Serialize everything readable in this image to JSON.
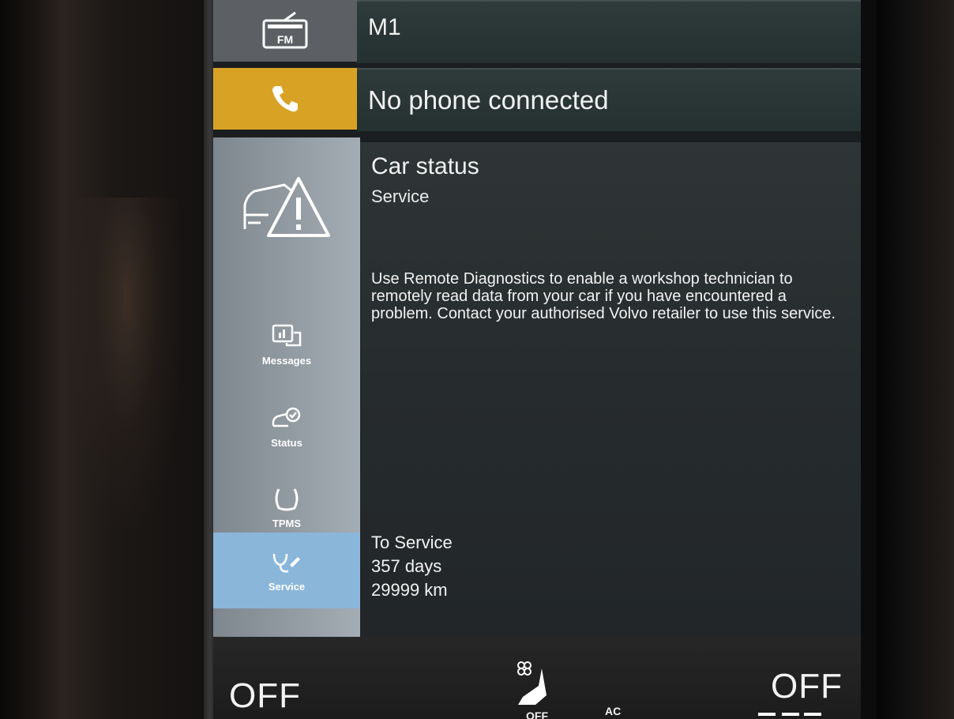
{
  "tiles": {
    "radio": {
      "icon": "fm-radio-icon",
      "badge": "FM",
      "title": "M1"
    },
    "phone": {
      "icon": "phone-icon",
      "title": "No phone connected"
    }
  },
  "app": {
    "title": "Car status",
    "subtitle": "Service",
    "description": "Use Remote Diagnostics to enable a workshop technician to remotely read data from your car if you have encountered a problem. Contact your authorised Volvo retailer to use this service.",
    "service": {
      "heading": "To Service",
      "days": "357 days",
      "distance": "29999 km"
    },
    "nav": [
      {
        "label": "Messages",
        "icon": "messages-icon"
      },
      {
        "label": "Status",
        "icon": "car-check-icon"
      },
      {
        "label": "TPMS",
        "icon": "tyre-pressure-icon"
      },
      {
        "label": "Service",
        "icon": "service-icon",
        "active": true
      }
    ]
  },
  "climate": {
    "left_temp": "OFF",
    "right_temp": "OFF",
    "fan": "OFF",
    "ac": "AC"
  },
  "colors": {
    "phone_accent": "#d8a325",
    "active_nav": "#8ab6da",
    "sidebar": "#a4acb4"
  }
}
